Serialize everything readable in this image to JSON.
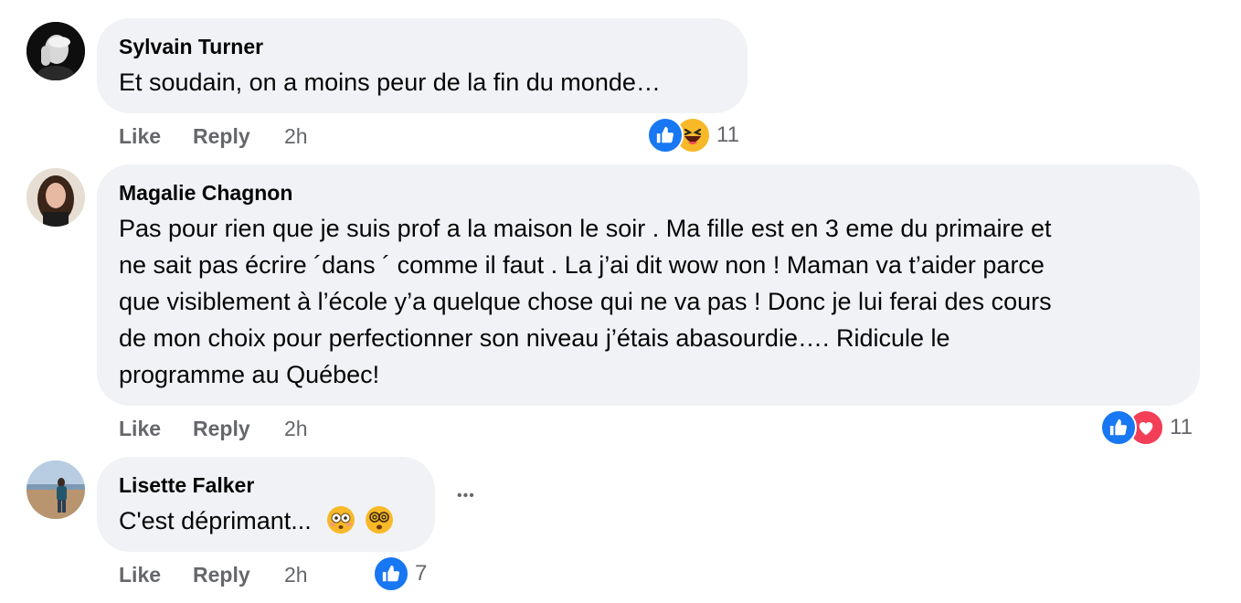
{
  "comments": [
    {
      "author": "Sylvain Turner",
      "text": "Et soudain, on a moins peur de la fin du monde…",
      "like_label": "Like",
      "reply_label": "Reply",
      "time": "2h",
      "reaction_icons": [
        "like-icon",
        "haha-icon"
      ],
      "reaction_count": "11"
    },
    {
      "author": "Magalie Chagnon",
      "text_lines": [
        "Pas pour rien que je suis prof a la maison le soir . Ma fille est en 3 eme du primaire et",
        "ne sait pas écrire ´dans ´ comme il faut . La j’ai dit wow non ! Maman va t’aider parce",
        "que visiblement à l’école y’a quelque chose qui ne va pas ! Donc je lui ferai des cours",
        "de mon choix pour perfectionner son niveau j’étais abasourdie…. Ridicule le",
        "programme au Québec!"
      ],
      "like_label": "Like",
      "reply_label": "Reply",
      "time": "2h",
      "reaction_icons": [
        "like-icon",
        "love-icon"
      ],
      "reaction_count": "11"
    },
    {
      "author": "Lisette Falker",
      "text": "C'est déprimant...",
      "text_emojis": [
        "flushed-face-emoji",
        "dizzy-face-emoji"
      ],
      "like_label": "Like",
      "reply_label": "Reply",
      "time": "2h",
      "reaction_icons": [
        "like-icon"
      ],
      "reaction_count": "7",
      "more_label": "•••"
    }
  ],
  "colors": {
    "bubble": "#f0f2f5",
    "secondary_text": "#65676b",
    "like_blue": "#1877f2",
    "haha_yellow": "#f7b928",
    "love_red": "#f33e58"
  }
}
